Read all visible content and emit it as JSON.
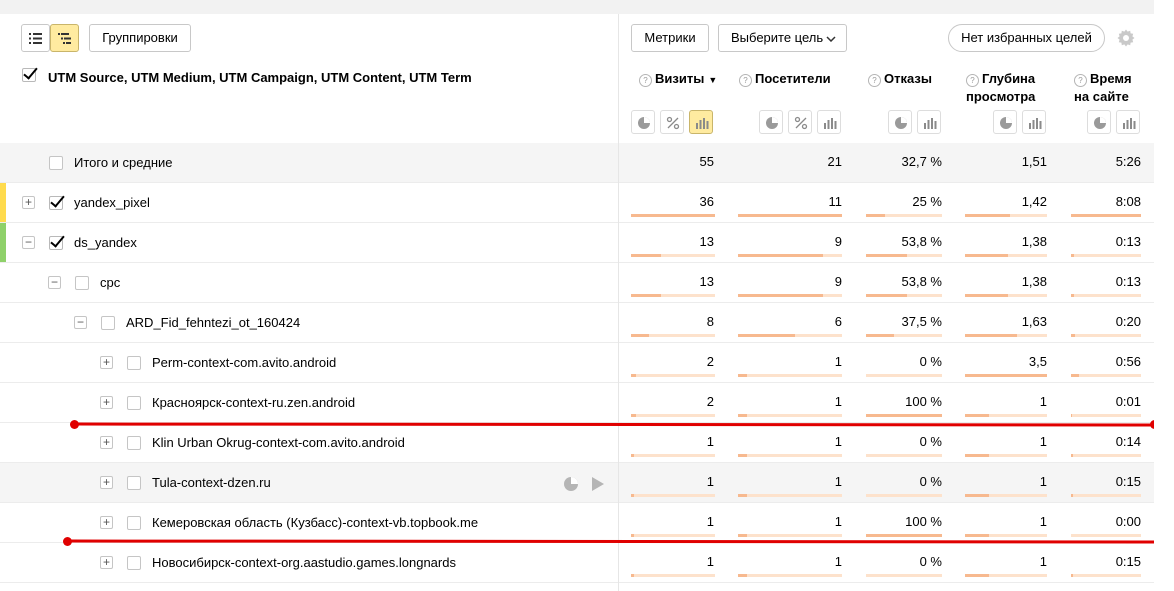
{
  "toolbar": {
    "groupings_label": "Группировки",
    "metrics_label": "Метрики",
    "goal_select_label": "Выберите цель",
    "favorites_label": "Нет избранных целей"
  },
  "header": {
    "dimension_title": "UTM Source, UTM Medium, UTM Campaign, UTM Content, UTM Term",
    "columns": [
      {
        "line1": "Визиты",
        "line2": "",
        "sort": "▼"
      },
      {
        "line1": "Посетители",
        "line2": ""
      },
      {
        "line1": "Отказы",
        "line2": ""
      },
      {
        "line1": "Глубина",
        "line2": "просмотра"
      },
      {
        "line1": "Время",
        "line2": "на сайте"
      }
    ]
  },
  "colors": {
    "accent_yellow": "#ffdb4d",
    "accent_green": "#8fd16a",
    "bar_track": "#fde2cc",
    "bar_fill": "#f7b98f",
    "annotation_red": "#e00000"
  },
  "rows": [
    {
      "label": "Итого и средние",
      "visits": "55",
      "visitors": "21",
      "bounce": "32,7 %",
      "depth": "1,51",
      "time": "5:26",
      "bars": []
    },
    {
      "label": "yandex_pixel",
      "visits": "36",
      "visitors": "11",
      "bounce": "25 %",
      "depth": "1,42",
      "time": "8:08",
      "bars": [
        1.0,
        1.0,
        0.25,
        0.55,
        1.0
      ]
    },
    {
      "label": "ds_yandex",
      "visits": "13",
      "visitors": "9",
      "bounce": "53,8 %",
      "depth": "1,38",
      "time": "0:13",
      "bars": [
        0.36,
        0.82,
        0.54,
        0.53,
        0.04
      ]
    },
    {
      "label": "cpc",
      "visits": "13",
      "visitors": "9",
      "bounce": "53,8 %",
      "depth": "1,38",
      "time": "0:13",
      "bars": [
        0.36,
        0.82,
        0.54,
        0.53,
        0.04
      ]
    },
    {
      "label": "ARD_Fid_fehntezi_ot_160424",
      "visits": "8",
      "visitors": "6",
      "bounce": "37,5 %",
      "depth": "1,63",
      "time": "0:20",
      "bars": [
        0.22,
        0.55,
        0.37,
        0.63,
        0.05
      ]
    },
    {
      "label": "Perm-context-com.avito.android",
      "visits": "2",
      "visitors": "1",
      "bounce": "0 %",
      "depth": "3,5",
      "time": "0:56",
      "bars": [
        0.06,
        0.09,
        0.0,
        1.0,
        0.12
      ]
    },
    {
      "label": "Красноярск-context-ru.zen.android",
      "visits": "2",
      "visitors": "1",
      "bounce": "100 %",
      "depth": "1",
      "time": "0:01",
      "bars": [
        0.06,
        0.09,
        1.0,
        0.29,
        0.01
      ]
    },
    {
      "label": "Klin Urban Okrug-context-com.avito.android",
      "visits": "1",
      "visitors": "1",
      "bounce": "0 %",
      "depth": "1",
      "time": "0:14",
      "bars": [
        0.03,
        0.09,
        0.0,
        0.29,
        0.03
      ]
    },
    {
      "label": "Tula-context-dzen.ru",
      "visits": "1",
      "visitors": "1",
      "bounce": "0 %",
      "depth": "1",
      "time": "0:15",
      "bars": [
        0.03,
        0.09,
        0.0,
        0.29,
        0.03
      ]
    },
    {
      "label": "Кемеровская область (Кузбасс)-context-vb.topbook.me",
      "visits": "1",
      "visitors": "1",
      "bounce": "100 %",
      "depth": "1",
      "time": "0:00",
      "bars": [
        0.03,
        0.09,
        1.0,
        0.29,
        0.0
      ]
    },
    {
      "label": "Новосибирск-context-org.aastudio.games.longnards",
      "visits": "1",
      "visitors": "1",
      "bounce": "0 %",
      "depth": "1",
      "time": "0:15",
      "bars": [
        0.03,
        0.09,
        0.0,
        0.29,
        0.03
      ]
    }
  ]
}
